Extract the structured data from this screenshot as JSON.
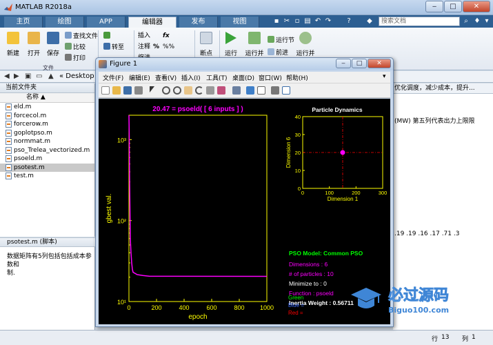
{
  "window": {
    "title": "MATLAB R2018a"
  },
  "tabs": [
    "主页",
    "绘图",
    "APP",
    "编辑器",
    "发布",
    "视图"
  ],
  "active_tab": "编辑器",
  "search": {
    "placeholder": "搜索文档"
  },
  "ribbon": {
    "new": "新建",
    "open": "打开",
    "save": "保存",
    "find_files": "查找文件",
    "compare": "比较",
    "print": "打印",
    "file_group": "文件",
    "insert": "插入",
    "fx": "fx",
    "goto": "转至",
    "comment": "注释",
    "indent": "缩进",
    "breakpoint": "断点",
    "run": "运行",
    "run_advance": "运行并",
    "run_section": "运行节",
    "advance": "前进",
    "run_time": "运行并"
  },
  "pathbar": {
    "back": "◀",
    "forward": "▶",
    "up": "▲",
    "path": "« Desktop ▸"
  },
  "folder_panel": {
    "title": "当前文件夹",
    "col_name": "名称 ▲",
    "files": [
      "eld.m",
      "forcecol.m",
      "forcerow.m",
      "goplotpso.m",
      "normmat.m",
      "pso_Trelea_vectorized.m",
      "psoeld.m",
      "psotest.m",
      "test.m"
    ],
    "selected": "psotest.m"
  },
  "details": {
    "title": "psotest.m  (脚本)",
    "line1": "数据矩阵有5列包括包括成本参数和",
    "line2": "制."
  },
  "editor": {
    "bar": "优化调度，减少成本，提升...",
    "line1": "(MW) 第五列代表出力上限限",
    "line2": ".19 .19 .16 .17 .71 .3"
  },
  "statusbar": {
    "row": "行",
    "row_val": "13",
    "col": "列",
    "col_val": "1"
  },
  "figure": {
    "title": "Figure 1",
    "menu": [
      "文件(F)",
      "编辑(E)",
      "查看(V)",
      "插入(I)",
      "工具(T)",
      "桌面(D)",
      "窗口(W)",
      "帮助(H)"
    ]
  },
  "watermark": {
    "text": "必过源码",
    "sub": "Biguo100.com"
  },
  "chart_data": [
    {
      "type": "line",
      "title": "20.47 = psoeld( [ 6 inputs ] )",
      "xlabel": "epoch",
      "ylabel": "gbest val.",
      "xlim": [
        0,
        1000
      ],
      "ylim": [
        10,
        2000
      ],
      "yscale": "log",
      "xticks": [
        "0",
        "200",
        "400",
        "600",
        "800",
        "1000"
      ],
      "yticks": [
        "10¹",
        "10²",
        "10³"
      ],
      "series": [
        {
          "color": "#ff00ff",
          "x": [
            0,
            2,
            5,
            10,
            15,
            20,
            25,
            30,
            40,
            60,
            100,
            150,
            1000
          ],
          "y": [
            2000,
            1200,
            300,
            60,
            40,
            30,
            25,
            23,
            22.5,
            21.5,
            21,
            20.5,
            20.47
          ]
        }
      ]
    },
    {
      "type": "scatter",
      "title": "Particle Dynamics",
      "xlabel": "Dimension 1",
      "ylabel": "Dimension 6",
      "xlim": [
        0,
        300
      ],
      "ylim": [
        0,
        40
      ],
      "xticks": [
        "0",
        "100",
        "200",
        "300"
      ],
      "yticks": [
        "0",
        "10",
        "20",
        "30",
        "40"
      ],
      "points": [
        {
          "x": 150,
          "y": 20
        }
      ],
      "crosshair": {
        "x": 150,
        "y": 20
      }
    }
  ],
  "info": {
    "model": "PSO Model: Common PSO",
    "dimensions": "Dimensions : 6",
    "particles": "# of particles :  10",
    "minimize": "Minimize to :  0",
    "function": "Function : psoeld",
    "inertia": "Inertia Weight : 0.56711",
    "legend_green": "Green = Personal Bests",
    "legend_blue": "Blue  = Current Pos.",
    "legend_red": "Red   = Global Best"
  },
  "colors": {
    "accent": "#2d5f92",
    "plot_bg": "#000000",
    "line": "#ff00ff",
    "axes": "#ffff00"
  }
}
